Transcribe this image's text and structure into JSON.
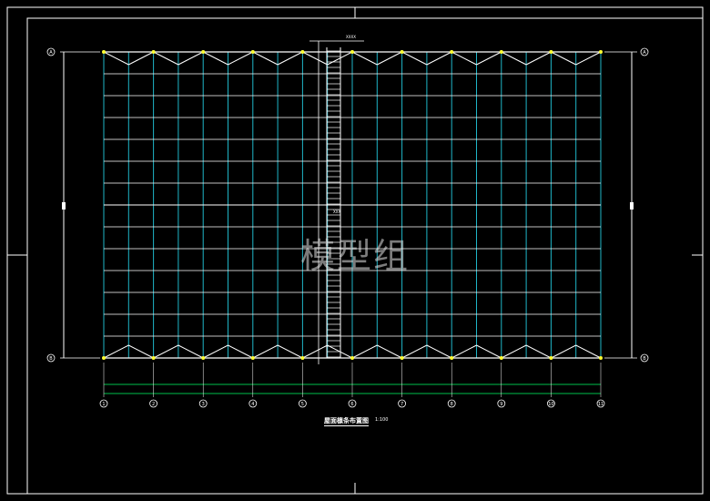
{
  "drawing": {
    "bay_count": 20,
    "span_rows": 12,
    "colors": {
      "background": "#000000",
      "frame": "#ffffff",
      "grid_cyan": "#1fb6c8",
      "column_marker": "#ffff33",
      "dim_line": "#00ff66"
    }
  },
  "grid_bubbles": {
    "bottom": [
      "1",
      "2",
      "3",
      "4",
      "5",
      "6",
      "7",
      "8",
      "9",
      "10",
      "11"
    ],
    "left": [
      "A",
      "B"
    ],
    "right": [
      "A",
      "B"
    ]
  },
  "labels": {
    "watermark": "模型组",
    "plan_title": "屋面檩条布置图",
    "plan_scale": "1:100",
    "top_note": "XXXX",
    "mid_note": "XXX"
  }
}
